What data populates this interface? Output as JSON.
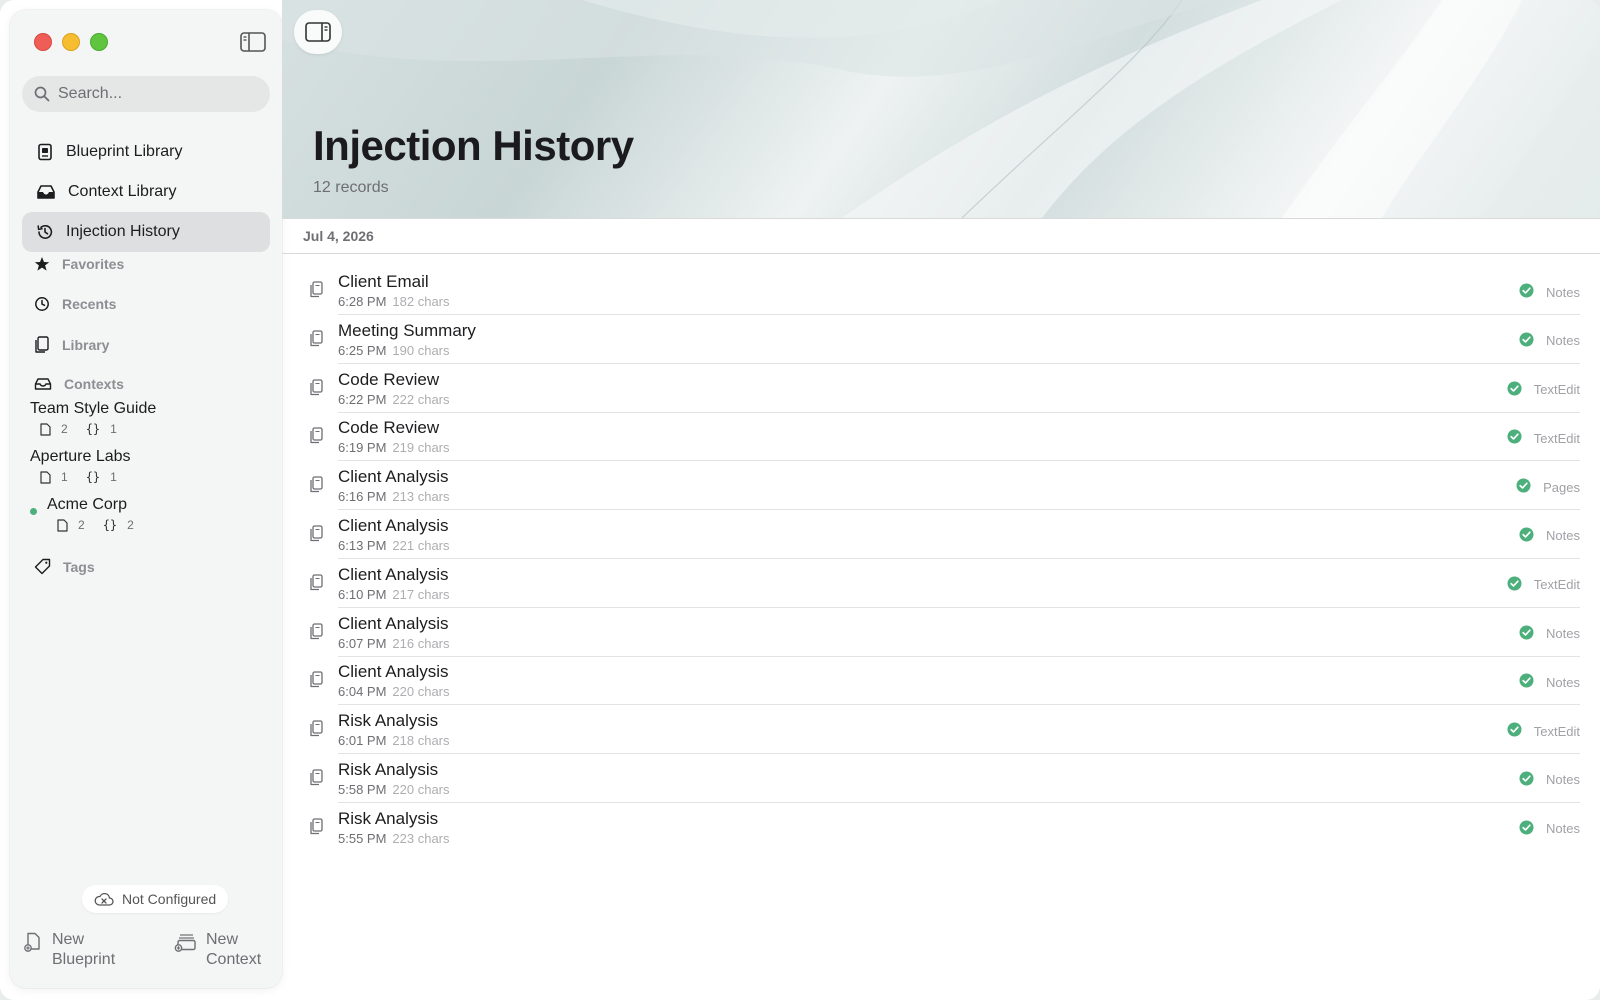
{
  "sidebar": {
    "search_placeholder": "Search...",
    "nav": [
      {
        "label": "Blueprint Library",
        "icon": "blueprint-book-icon"
      },
      {
        "label": "Context Library",
        "icon": "tray-icon"
      },
      {
        "label": "Injection History",
        "icon": "history-clock-icon",
        "active": true
      }
    ],
    "sections": {
      "favorites": "Favorites",
      "recents": "Recents",
      "library": "Library",
      "contexts": "Contexts",
      "tags": "Tags"
    },
    "contexts": [
      {
        "name": "Team Style Guide",
        "docs": "2",
        "vars": "1",
        "active": false
      },
      {
        "name": "Aperture Labs",
        "docs": "1",
        "vars": "1",
        "active": false
      },
      {
        "name": "Acme Corp",
        "docs": "2",
        "vars": "2",
        "active": true
      }
    ],
    "sync_status": "Not Configured",
    "new_blueprint": {
      "line1": "New",
      "line2": "Blueprint"
    },
    "new_context": {
      "line1": "New",
      "line2": "Context"
    }
  },
  "main": {
    "title": "Injection History",
    "subtitle": "12 records",
    "date_header": "Jul 4, 2026",
    "records": [
      {
        "title": "Client Email",
        "time": "6:28 PM",
        "chars": "182 chars",
        "app": "Notes"
      },
      {
        "title": "Meeting Summary",
        "time": "6:25 PM",
        "chars": "190 chars",
        "app": "Notes"
      },
      {
        "title": "Code Review",
        "time": "6:22 PM",
        "chars": "222 chars",
        "app": "TextEdit"
      },
      {
        "title": "Code Review",
        "time": "6:19 PM",
        "chars": "219 chars",
        "app": "TextEdit"
      },
      {
        "title": "Client Analysis",
        "time": "6:16 PM",
        "chars": "213 chars",
        "app": "Pages"
      },
      {
        "title": "Client Analysis",
        "time": "6:13 PM",
        "chars": "221 chars",
        "app": "Notes"
      },
      {
        "title": "Client Analysis",
        "time": "6:10 PM",
        "chars": "217 chars",
        "app": "TextEdit"
      },
      {
        "title": "Client Analysis",
        "time": "6:07 PM",
        "chars": "216 chars",
        "app": "Notes"
      },
      {
        "title": "Client Analysis",
        "time": "6:04 PM",
        "chars": "220 chars",
        "app": "Notes"
      },
      {
        "title": "Risk Analysis",
        "time": "6:01 PM",
        "chars": "218 chars",
        "app": "TextEdit"
      },
      {
        "title": "Risk Analysis",
        "time": "5:58 PM",
        "chars": "220 chars",
        "app": "Notes"
      },
      {
        "title": "Risk Analysis",
        "time": "5:55 PM",
        "chars": "223 chars",
        "app": "Notes"
      }
    ]
  },
  "colors": {
    "accent_green": "#4caf7c",
    "active_item_bg": "#dedfe0"
  }
}
